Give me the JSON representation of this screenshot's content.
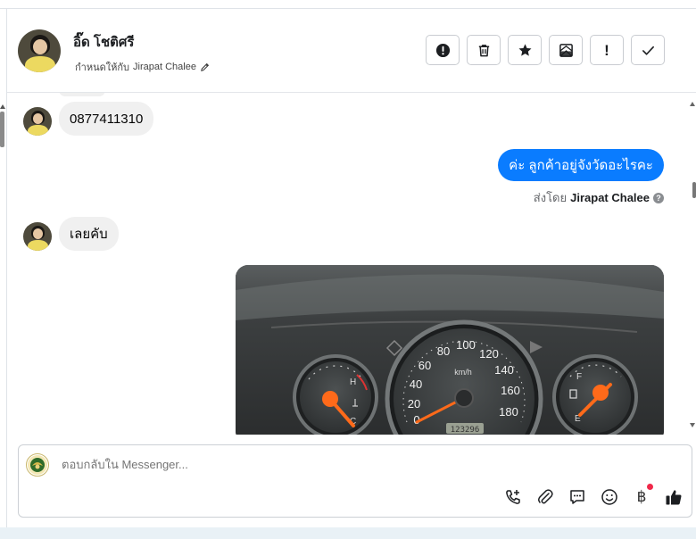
{
  "header": {
    "contact_name": "อิ๊ด โชติศรี",
    "assigned_prefix": "กำหนดให้กับ",
    "assigned_name": "Jirapat Chalee",
    "actions": [
      {
        "name": "spam-button",
        "icon": "exclamation-circle-icon"
      },
      {
        "name": "delete-button",
        "icon": "trash-icon"
      },
      {
        "name": "star-button",
        "icon": "star-icon"
      },
      {
        "name": "mark-unread-button",
        "icon": "mail-icon"
      },
      {
        "name": "follow-up-button",
        "icon": "exclamation-icon"
      },
      {
        "name": "mark-done-button",
        "icon": "checkmark-icon"
      }
    ]
  },
  "messages": [
    {
      "direction": "in",
      "text": "0877411310"
    },
    {
      "direction": "out",
      "text": "ค่ะ ลูกค้าอยู่จังวัดอะไรคะ",
      "sent_by_prefix": "ส่งโดย",
      "sent_by_name": "Jirapat Chalee"
    },
    {
      "direction": "in",
      "text": "เลยคับ"
    },
    {
      "direction": "out",
      "type": "image",
      "image_subject": "car-dashboard-photo"
    }
  ],
  "gauges": {
    "temp_labels": [
      "H",
      "C"
    ],
    "fuel_labels": [
      "F",
      "E"
    ],
    "speed_unit": "km/h",
    "speed_ticks": [
      "0",
      "20",
      "40",
      "60",
      "80",
      "100",
      "120",
      "140",
      "160",
      "180"
    ],
    "odometer": "123296"
  },
  "composer": {
    "placeholder": "ตอบกลับใน Messenger...",
    "icons": [
      "phone-add-icon",
      "paperclip-icon",
      "chat-bubble-icon",
      "smiley-icon",
      "baht-icon",
      "thumbs-up-icon"
    ],
    "baht_symbol": "฿",
    "notification_color": "#f02849"
  },
  "colors": {
    "outgoing_bubble": "#0a7cff",
    "incoming_bubble": "#f0f0f0"
  }
}
